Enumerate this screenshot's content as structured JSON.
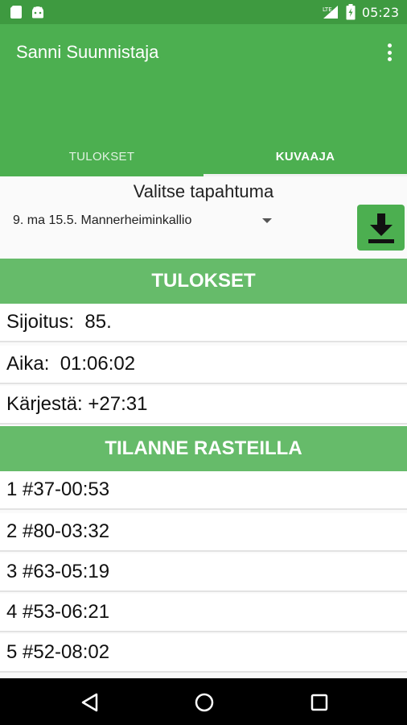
{
  "status_bar": {
    "time": "05:23",
    "network": "LTE"
  },
  "app_bar": {
    "title": "Sanni Suunnistaja"
  },
  "tabs": [
    {
      "label": "TULOKSET",
      "selected": false
    },
    {
      "label": "KUVAAJA",
      "selected": true
    }
  ],
  "event": {
    "heading": "Valitse tapahtuma",
    "selected": "9. ma 15.5. Mannerheiminkallio"
  },
  "results": {
    "header": "TULOKSET",
    "rows": [
      {
        "text": "Sijoitus:  85."
      },
      {
        "text": "Aika:  01:06:02"
      },
      {
        "text": "Kärjestä: +27:31"
      }
    ]
  },
  "checkpoints": {
    "header": "TILANNE RASTEILLA",
    "rows": [
      {
        "text": "1 #37-00:53"
      },
      {
        "text": "2 #80-03:32"
      },
      {
        "text": "3 #63-05:19"
      },
      {
        "text": "4 #53-06:21"
      },
      {
        "text": "5 #52-08:02"
      }
    ]
  },
  "colors": {
    "primary": "#4caf50",
    "primary_dark": "#3e9a40",
    "section_header": "#66bb6a"
  },
  "icons": {
    "download": "download-icon",
    "overflow": "overflow-menu-icon"
  }
}
